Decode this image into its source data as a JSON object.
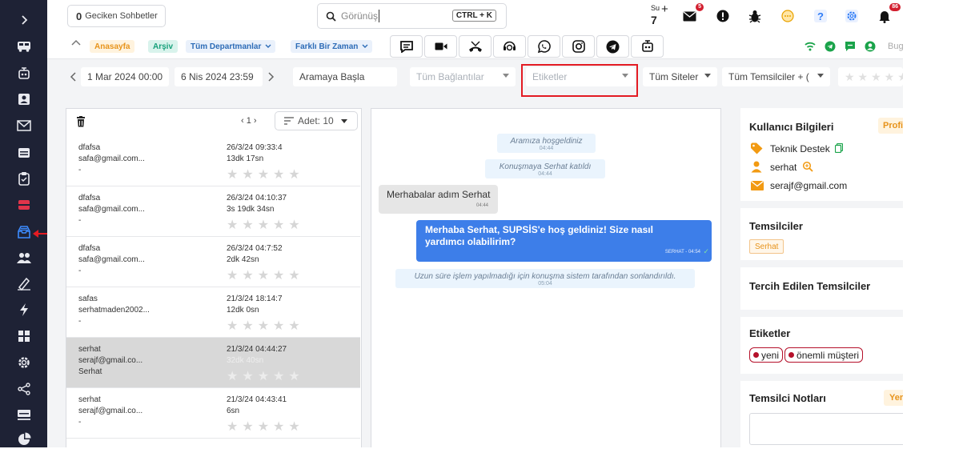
{
  "sidebar": {
    "icons": [
      "chevron-right-icon",
      "bus-icon",
      "robot-icon",
      "contact-card-icon",
      "mail-icon",
      "calendar-icon",
      "clipboard-icon",
      "ticket-icon",
      "inbox-archive-icon",
      "users-icon",
      "signature-icon",
      "lightning-icon",
      "dashboard-icon",
      "gear-icon",
      "share-icon",
      "monitor-icon",
      "pie-chart-icon"
    ]
  },
  "topbar": {
    "late_count": "0",
    "late_label": "Geciken Sohbetler",
    "search_placeholder": "Görünüş",
    "search_shortcut": "CTRL + K",
    "day_label": "Su",
    "day_number": "7",
    "mail_badge": "5",
    "notif_badge": "86"
  },
  "tabs": {
    "home": "Anasayfa",
    "archive": "Arşiv",
    "departments": "Tüm Departmanlar",
    "timezone": "Farklı Bir Zaman",
    "today_label": "Bug"
  },
  "filters": {
    "start_date": "1 Mar 2024 00:00",
    "end_date": "6 Nis 2024 23:59",
    "search_placeholder": "Aramaya Başla",
    "connections": "Tüm Bağlantılar",
    "tags": "Etiketler",
    "sites": "Tüm Siteler",
    "agents": "Tüm Temsilciler + (",
    "stars": "★★★★★"
  },
  "list": {
    "pager": "‹ 1 ›",
    "count_label": "Adet: 10",
    "conversations": [
      {
        "name": "dfafsa",
        "email": "safa@gmail.com...",
        "extra": "-",
        "date": "26/3/24 09:33:4",
        "duration": "13dk 17sn",
        "stars": "★★★★★"
      },
      {
        "name": "dfafsa",
        "email": "safa@gmail.com...",
        "extra": "-",
        "date": "26/3/24 04:10:37",
        "duration": "3s 19dk 34sn",
        "stars": "★★★★★"
      },
      {
        "name": "dfafsa",
        "email": "safa@gmail.com...",
        "extra": "-",
        "date": "26/3/24 04:7:52",
        "duration": "2dk 42sn",
        "stars": "★★★★★"
      },
      {
        "name": "safas",
        "email": "serhatmaden2002...",
        "extra": "-",
        "date": "21/3/24 18:14:7",
        "duration": "12dk 0sn",
        "stars": "★★★★★"
      },
      {
        "name": "serhat",
        "email": "serajf@gmail.co...",
        "extra": "Serhat",
        "date": "21/3/24 04:44:27",
        "duration": "32dk 40sn",
        "stars": "★★★★★"
      },
      {
        "name": "serhat",
        "email": "serajf@gmail.co...",
        "extra": "-",
        "date": "21/3/24 04:43:41",
        "duration": "6sn",
        "stars": "★★★★★"
      }
    ]
  },
  "chat": {
    "welcome": "Aramıza hoşgeldiniz",
    "welcome_time": "04:44",
    "joined": "Konuşmaya Serhat katıldı",
    "joined_time": "04:44",
    "user_msg": "Merhabalar adım Serhat",
    "user_time": "04:44",
    "agent_msg": "Merhaba Serhat, SUPSİS'e hoş geldiniz! Size nasıl yardımcı olabilirim?",
    "agent_meta": "SERHAT - 04:54",
    "closed": "Uzun süre işlem yapılmadığı için konuşma sistem tarafından sonlandırıldı.",
    "closed_time": "05:04"
  },
  "right": {
    "user_info_title": "Kullanıcı Bilgileri",
    "profile_btn": "Profi",
    "department": "Teknik Destek",
    "username": "serhat",
    "email": "serajf@gmail.com",
    "agents_title": "Temsilciler",
    "agent_tag": "Serhat",
    "preferred_title": "Tercih Edilen Temsilciler",
    "tags_title": "Etiketler",
    "tags": [
      "yeni",
      "önemli müşteri"
    ],
    "notes_title": "Temsilci Notları",
    "notes_btn": "Yer"
  }
}
